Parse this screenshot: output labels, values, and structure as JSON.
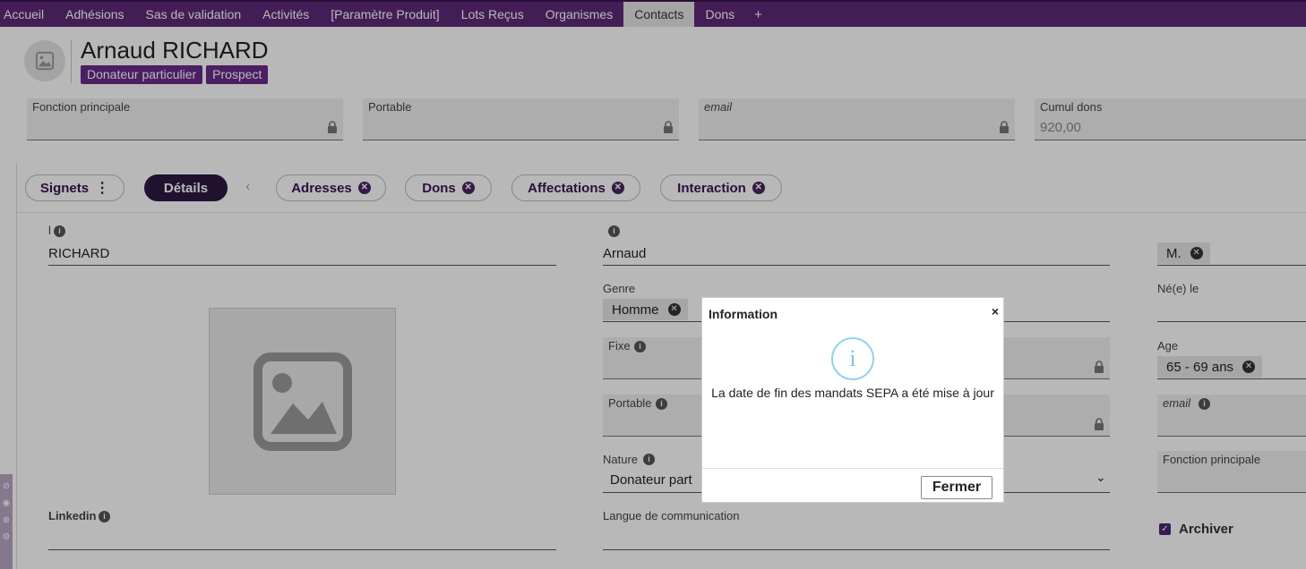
{
  "nav": {
    "items": [
      "Accueil",
      "Adhésions",
      "Sas de validation",
      "Activités",
      "[Paramètre Produit]",
      "Lots Reçus",
      "Organismes",
      "Contacts",
      "Dons"
    ],
    "active_index": 7,
    "add_label": "+"
  },
  "header": {
    "name": "Arnaud RICHARD",
    "badges": [
      "Donateur particulier",
      "Prospect"
    ]
  },
  "summary": {
    "fonction_label": "Fonction principale",
    "portable_label": "Portable",
    "email_label": "email",
    "cumul_label": "Cumul dons",
    "cumul_value": "920,00"
  },
  "tabs": {
    "signets": "Signets",
    "details": "Détails",
    "adresses": "Adresses",
    "dons": "Dons",
    "affectations": "Affectations",
    "interaction": "Interaction"
  },
  "form": {
    "nom_label": "l",
    "nom_value": "RICHARD",
    "prenom_value": "Arnaud",
    "civilite_value": "M.",
    "genre_label": "Genre",
    "genre_value": "Homme",
    "ne_le_label": "Né(e) le",
    "fixe_label": "Fixe",
    "age_label": "Age",
    "age_value": "65 - 69 ans",
    "portable_label": "Portable",
    "email_label": "email",
    "nature_label": "Nature",
    "nature_value": "Donateur part",
    "fonction_label": "Fonction principale",
    "linkedin_label": "Linkedin",
    "langue_label": "Langue de communication",
    "archiver_label": "Archiver"
  },
  "modal": {
    "title": "Information",
    "close": "×",
    "icon": "i",
    "message": "La date de fin des mandats SEPA a été mise à jour",
    "button": "Fermer"
  },
  "colors": {
    "nav_bg": "#5e2a78",
    "badge": "#6a2a8a",
    "accent_dark": "#2d1840",
    "info_icon": "#8fd4e8"
  }
}
